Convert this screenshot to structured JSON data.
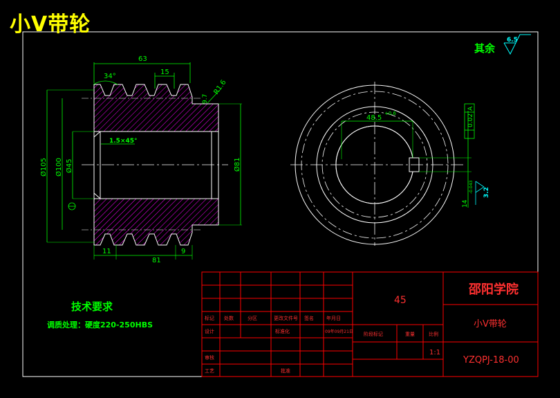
{
  "drawing_title": "小V带轮",
  "surface_finish": {
    "label": "其余",
    "roughness": "6.5"
  },
  "front_view": {
    "dimensions": {
      "overall_length": "63",
      "groove_pitch": "15",
      "groove_angle": "34°",
      "radius": "R1.6",
      "small_step": "9.7",
      "chamfer": "1.5×45°",
      "outer_dia": "Ø105",
      "pitch_dia": "Ø100",
      "bore_dia": "Ø45",
      "hub_dia": "Ø81",
      "left_offset": "11",
      "hub_length": "81",
      "right_offset": "9"
    }
  },
  "side_view": {
    "dimensions": {
      "keyway_width": "48.5",
      "keyway_tol": "+0.6",
      "keyway_depth": "14",
      "keyway_depth_tol": "-0.043",
      "tolerance_frame": [
        "0.02",
        "A"
      ],
      "roughness": "3.2"
    }
  },
  "technical_requirements": {
    "heading": "技术要求",
    "text": "调质处理：硬度220-250HBS"
  },
  "title_block": {
    "material": "45",
    "school": "邵阳学院",
    "part_name": "小V带轮",
    "drawing_no": "YZQPJ-18-00",
    "scale": "1:1",
    "labels": {
      "mark": "标记",
      "count": "处数",
      "zone": "分区",
      "doc_no": "更改文件号",
      "sign": "签名",
      "date": "年月日",
      "design": "设计",
      "check": "审核",
      "process": "工艺",
      "standard": "标准化",
      "approve": "批准",
      "stage_mark": "阶段标记",
      "weight": "重量",
      "ratio": "比例",
      "design_date": "09年09月21日"
    }
  },
  "colors": {
    "geometry": "#ffffff",
    "dimension": "#00ff00",
    "hatch": "#ff00ff",
    "centerline": "#ffffff",
    "title_block_lines": "#ff0000",
    "title_block_text": "#ff3030",
    "tolerance": "#00ffff"
  }
}
